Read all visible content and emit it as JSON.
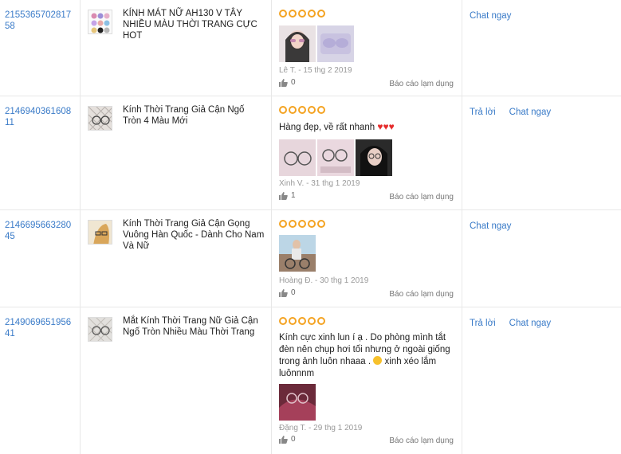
{
  "reviews": [
    {
      "order_id": "215536570281758",
      "product_name": "KÍNH MÁT NỮ AH130 V TÂY NHIỀU MÀU THỜI TRANG CỰC HOT",
      "review_text": "",
      "reviewer": "Lê T. - 15 thg 2 2019",
      "likes": "0",
      "report_label": "Báo cáo lạm dụng",
      "actions": [
        "Chat ngay"
      ]
    },
    {
      "order_id": "214694036160811",
      "product_name": "Kính Thời Trang Giả Cận Ngố Tròn 4 Màu Mới",
      "review_text": "Hàng đẹp, về rất nhanh",
      "reviewer": "Xinh V. - 31 thg 1 2019",
      "likes": "1",
      "report_label": "Báo cáo lạm dụng",
      "actions": [
        "Trả lời",
        "Chat ngay"
      ]
    },
    {
      "order_id": "214669566328045",
      "product_name": "Kính Thời Trang Giả Cận Gọng Vuông Hàn Quốc - Dành Cho Nam Và Nữ",
      "review_text": "",
      "reviewer": "Hoàng Đ. - 30 thg 1 2019",
      "likes": "0",
      "report_label": "Báo cáo lạm dụng",
      "actions": [
        "Chat ngay"
      ]
    },
    {
      "order_id": "214906965195641",
      "product_name": "Mắt Kính Thời Trang Nữ Giả Cận Ngố Tròn Nhiều Màu Thời Trang",
      "review_text": "Kính cực xinh lun í ạ . Do phòng mình tắt đèn nên chụp hơi tối nhưng ở ngoài giống trong ảnh luôn nhaaa .",
      "review_text_tail": "xinh xéo lắm luônnnm",
      "reviewer": "Đặng T. - 29 thg 1 2019",
      "likes": "0",
      "report_label": "Báo cáo lạm dụng",
      "actions": [
        "Trả lời",
        "Chat ngay"
      ]
    }
  ],
  "colors": {
    "link": "#3a7bc8",
    "star": "#f4a322",
    "heart": "#e52c2c",
    "border": "#e8e8e8"
  },
  "icons": {
    "rating": "star-icon",
    "like": "thumbs-up-icon",
    "heart": "heart-icon",
    "emoji": "heart-eyes-emoji-icon"
  }
}
